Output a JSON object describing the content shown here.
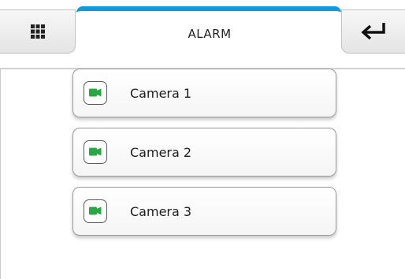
{
  "header": {
    "title": "ALARM",
    "menu_icon": "grid-icon",
    "back_icon": "return-arrow-icon",
    "accent_color": "#0a9be0"
  },
  "cameras": [
    {
      "label": "Camera 1",
      "icon": "video-camera-icon",
      "icon_color": "#28a745"
    },
    {
      "label": "Camera 2",
      "icon": "video-camera-icon",
      "icon_color": "#28a745"
    },
    {
      "label": "Camera 3",
      "icon": "video-camera-icon",
      "icon_color": "#28a745"
    }
  ]
}
